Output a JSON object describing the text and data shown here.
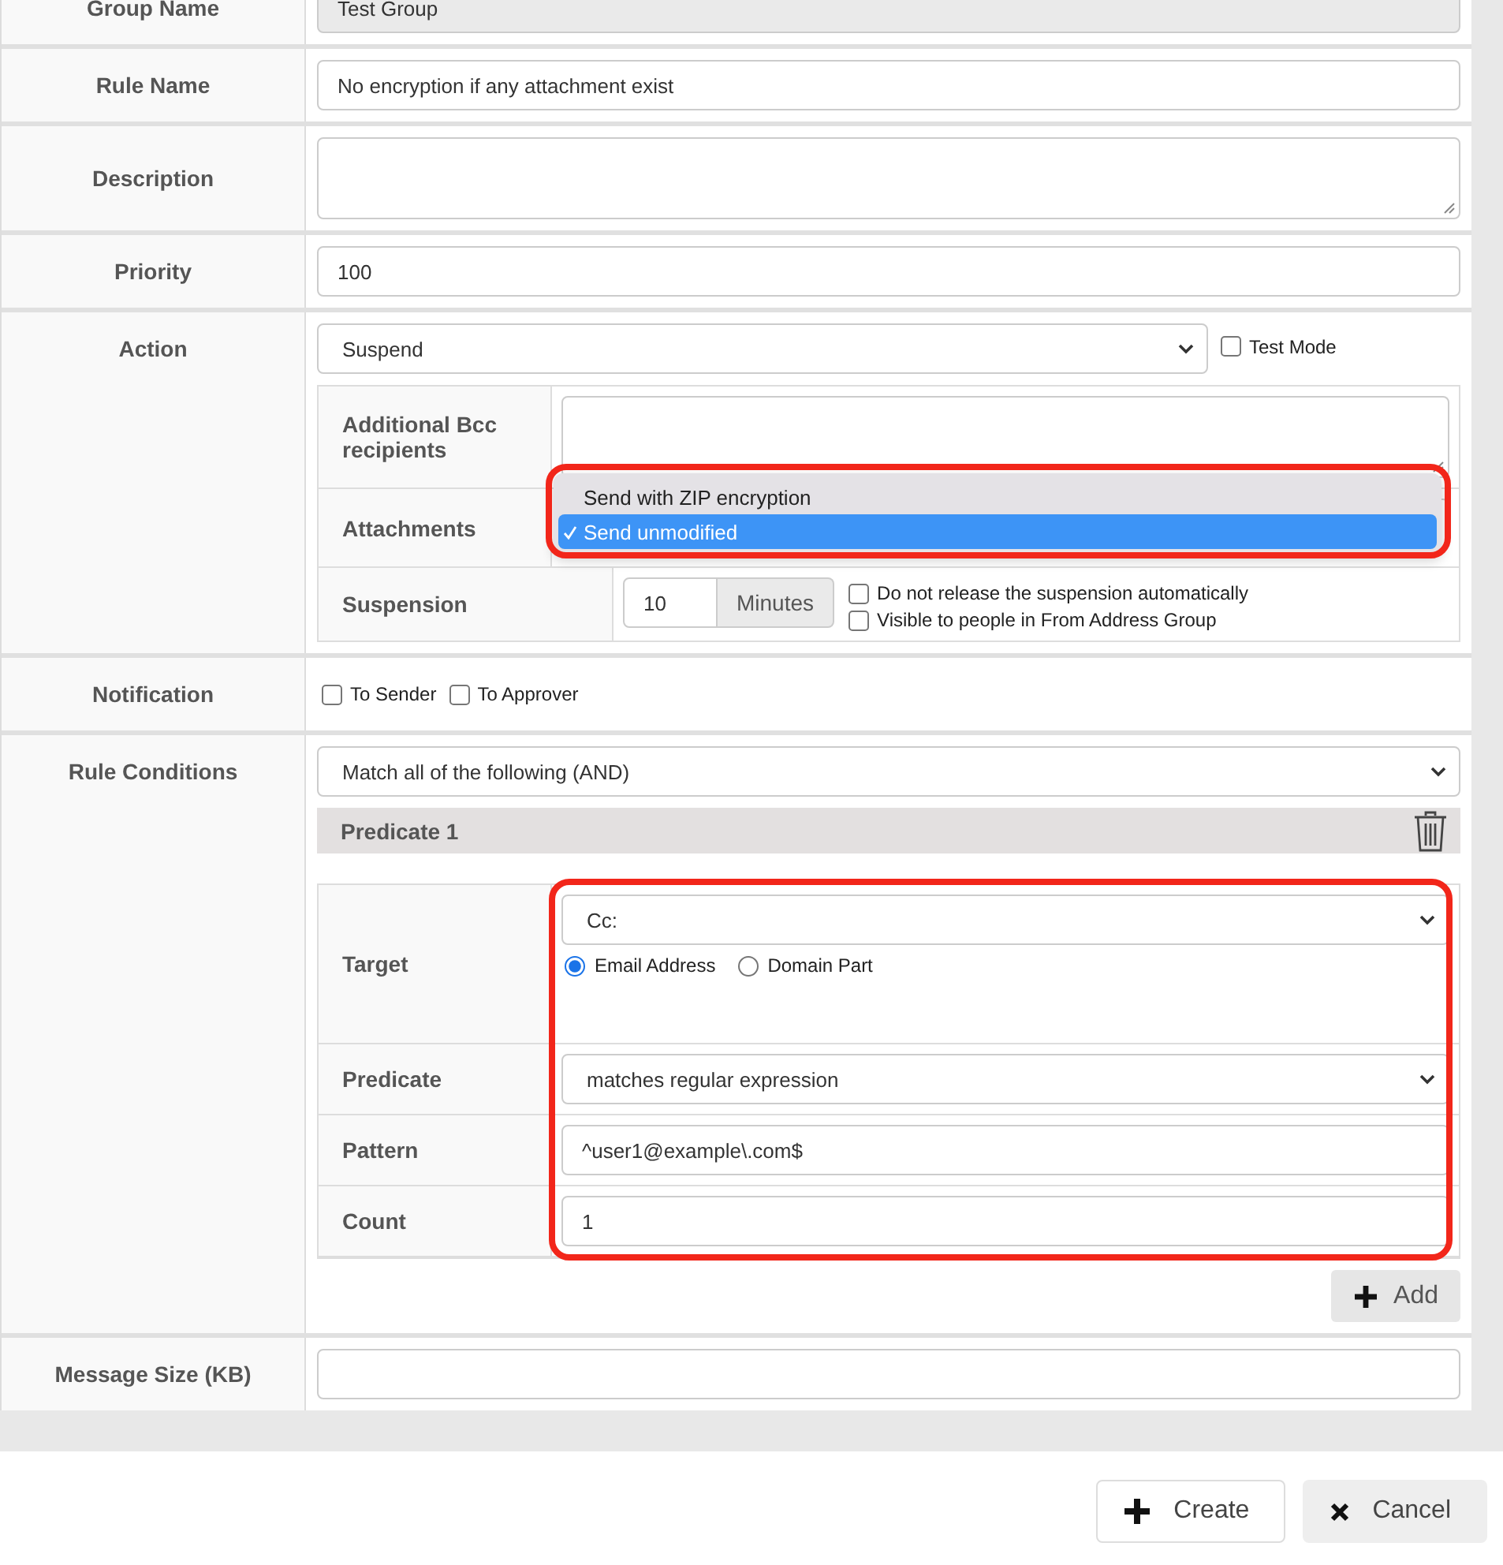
{
  "group_name": {
    "label": "Group Name",
    "value": "Test Group"
  },
  "rule_name": {
    "label": "Rule Name",
    "value": "No encryption if any attachment exist"
  },
  "description": {
    "label": "Description"
  },
  "priority": {
    "label": "Priority",
    "value": "100"
  },
  "action": {
    "label": "Action",
    "value": "Suspend",
    "test_mode": {
      "label": "Test Mode",
      "checked": false
    },
    "additional_bcc": {
      "label": "Additional Bcc recipients"
    },
    "attachments": {
      "label": "Attachments",
      "dropdown": {
        "expanded": true,
        "options": [
          {
            "label": "Send with ZIP encryption",
            "selected": false
          },
          {
            "label": "Send unmodified",
            "selected": true
          }
        ]
      }
    },
    "suspension": {
      "label": "Suspension",
      "value": "10",
      "unit": "Minutes",
      "options": [
        {
          "label": "Do not release the suspension automatically",
          "checked": false
        },
        {
          "label": "Visible to people in From Address Group",
          "checked": false
        }
      ]
    }
  },
  "notification": {
    "label": "Notification",
    "options": [
      {
        "label": "To Sender",
        "checked": false
      },
      {
        "label": "To Approver",
        "checked": false
      }
    ]
  },
  "rule_conditions": {
    "label": "Rule Conditions",
    "match": "Match all of the following (AND)",
    "predicates": [
      {
        "title": "Predicate 1",
        "target": {
          "label": "Target",
          "value": "Cc:",
          "scopes": [
            {
              "label": "Email Address",
              "selected": true
            },
            {
              "label": "Domain Part",
              "selected": false
            }
          ]
        },
        "predicate": {
          "label": "Predicate",
          "value": "matches regular expression"
        },
        "pattern": {
          "label": "Pattern",
          "value": "^user1@example\\.com$"
        },
        "count": {
          "label": "Count",
          "value": "1"
        }
      }
    ],
    "add_button": "Add"
  },
  "message_size": {
    "label": "Message Size (KB)"
  },
  "buttons": [
    {
      "kind": "create",
      "label": "Create"
    },
    {
      "kind": "cancel",
      "label": "Cancel"
    }
  ]
}
